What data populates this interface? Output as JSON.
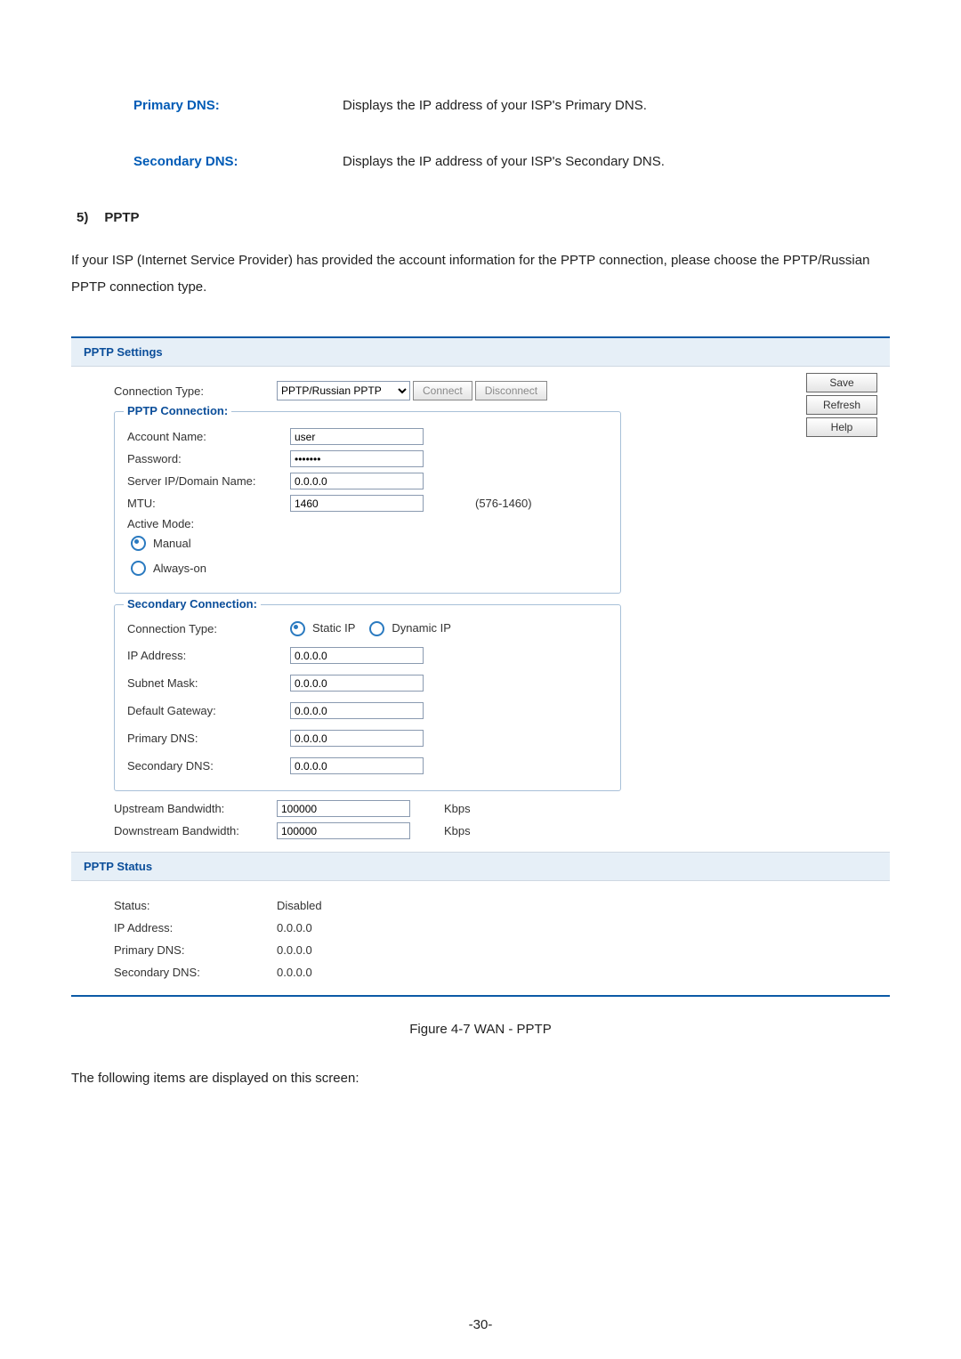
{
  "definitions": {
    "primaryDNS": {
      "term": "Primary DNS:",
      "desc": "Displays the IP address of your ISP's Primary DNS."
    },
    "secondaryDNS": {
      "term": "Secondary DNS:",
      "desc": "Displays the IP address of your ISP's Secondary DNS."
    }
  },
  "sectionNum": "5)",
  "sectionTitle": "PPTP",
  "intro": "If your ISP (Internet Service Provider) has provided the account information for the PPTP connection, please choose the PPTP/Russian PPTP connection type.",
  "panel": {
    "settingsTitle": "PPTP Settings",
    "connTypeLabel": "Connection Type:",
    "connTypeValue": "PPTP/Russian PPTP",
    "connectBtn": "Connect",
    "disconnectBtn": "Disconnect",
    "saveBtn": "Save",
    "refreshBtn": "Refresh",
    "helpBtn": "Help",
    "pptpConnTitle": "PPTP Connection:",
    "accountLabel": "Account Name:",
    "accountValue": "user",
    "passwordLabel": "Password:",
    "passwordValue": "•••••••",
    "serverLabel": "Server IP/Domain Name:",
    "serverValue": "0.0.0.0",
    "mtuLabel": "MTU:",
    "mtuValue": "1460",
    "mtuRange": "(576-1460)",
    "activeModeLabel": "Active Mode:",
    "manual": "Manual",
    "alwaysOn": "Always-on",
    "secondaryConnTitle": "Secondary Connection:",
    "secConnTypeLabel": "Connection Type:",
    "staticIP": "Static IP",
    "dynamicIP": "Dynamic IP",
    "ipLabel": "IP Address:",
    "ipValue": "0.0.0.0",
    "subnetLabel": "Subnet Mask:",
    "subnetValue": "0.0.0.0",
    "gatewayLabel": "Default Gateway:",
    "gatewayValue": "0.0.0.0",
    "priDNSLabel": "Primary DNS:",
    "priDNSValue": "0.0.0.0",
    "secDNSLabel": "Secondary DNS:",
    "secDNSValue": "0.0.0.0",
    "upBWLabel": "Upstream Bandwidth:",
    "upBWValue": "100000",
    "downBWLabel": "Downstream Bandwidth:",
    "downBWValue": "100000",
    "kbps": "Kbps",
    "statusTitle": "PPTP Status",
    "statusLabel": "Status:",
    "statusValue": "Disabled",
    "stIPLabel": "IP Address:",
    "stIPValue": "0.0.0.0",
    "stPriDNSLabel": "Primary DNS:",
    "stPriDNSValue": "0.0.0.0",
    "stSecDNSLabel": "Secondary DNS:",
    "stSecDNSValue": "0.0.0.0"
  },
  "figureCaption": "Figure 4-7 WAN - PPTP",
  "closingText": "The following items are displayed on this screen:",
  "pageNumber": "-30-"
}
